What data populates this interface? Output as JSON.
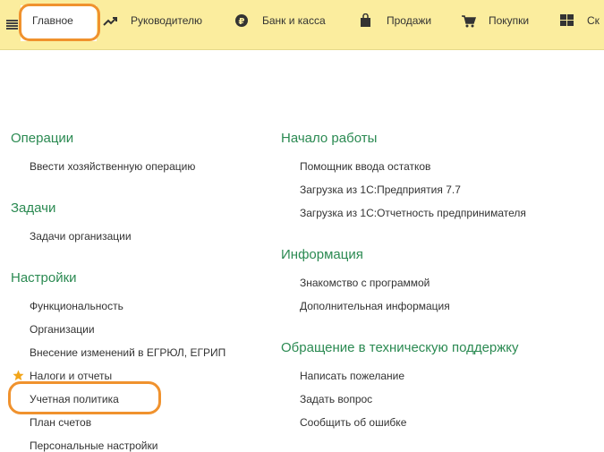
{
  "topbar": {
    "tabs": [
      {
        "label": "Главное",
        "icon": "menu-icon"
      },
      {
        "label": "Руководителю",
        "icon": "trend-up-icon"
      },
      {
        "label": "Банк и касса",
        "icon": "ruble-coin-icon"
      },
      {
        "label": "Продажи",
        "icon": "shopping-bag-icon"
      },
      {
        "label": "Покупки",
        "icon": "shopping-cart-icon"
      },
      {
        "label": "Ск",
        "icon": "grid-icon"
      }
    ]
  },
  "left": {
    "sections": [
      {
        "title": "Операции",
        "items": [
          "Ввести хозяйственную операцию"
        ]
      },
      {
        "title": "Задачи",
        "items": [
          "Задачи организации"
        ]
      },
      {
        "title": "Настройки",
        "items": [
          "Функциональность",
          "Организации",
          "Внесение изменений в ЕГРЮЛ, ЕГРИП",
          "Налоги и отчеты",
          "Учетная политика",
          "План счетов",
          "Персональные настройки"
        ]
      }
    ]
  },
  "right": {
    "sections": [
      {
        "title": "Начало работы",
        "items": [
          "Помощник ввода остатков",
          "Загрузка из 1С:Предприятия 7.7",
          "Загрузка из 1С:Отчетность предпринимателя"
        ]
      },
      {
        "title": "Информация",
        "items": [
          "Знакомство с программой",
          "Дополнительная информация"
        ]
      },
      {
        "title": "Обращение в техническую поддержку",
        "items": [
          "Написать пожелание",
          "Задать вопрос",
          "Сообщить об ошибке"
        ]
      }
    ]
  },
  "colors": {
    "topbar_bg": "#fbed9e",
    "section_title": "#2b8a52",
    "highlight": "#f0922e",
    "star": "#f2a51a"
  }
}
